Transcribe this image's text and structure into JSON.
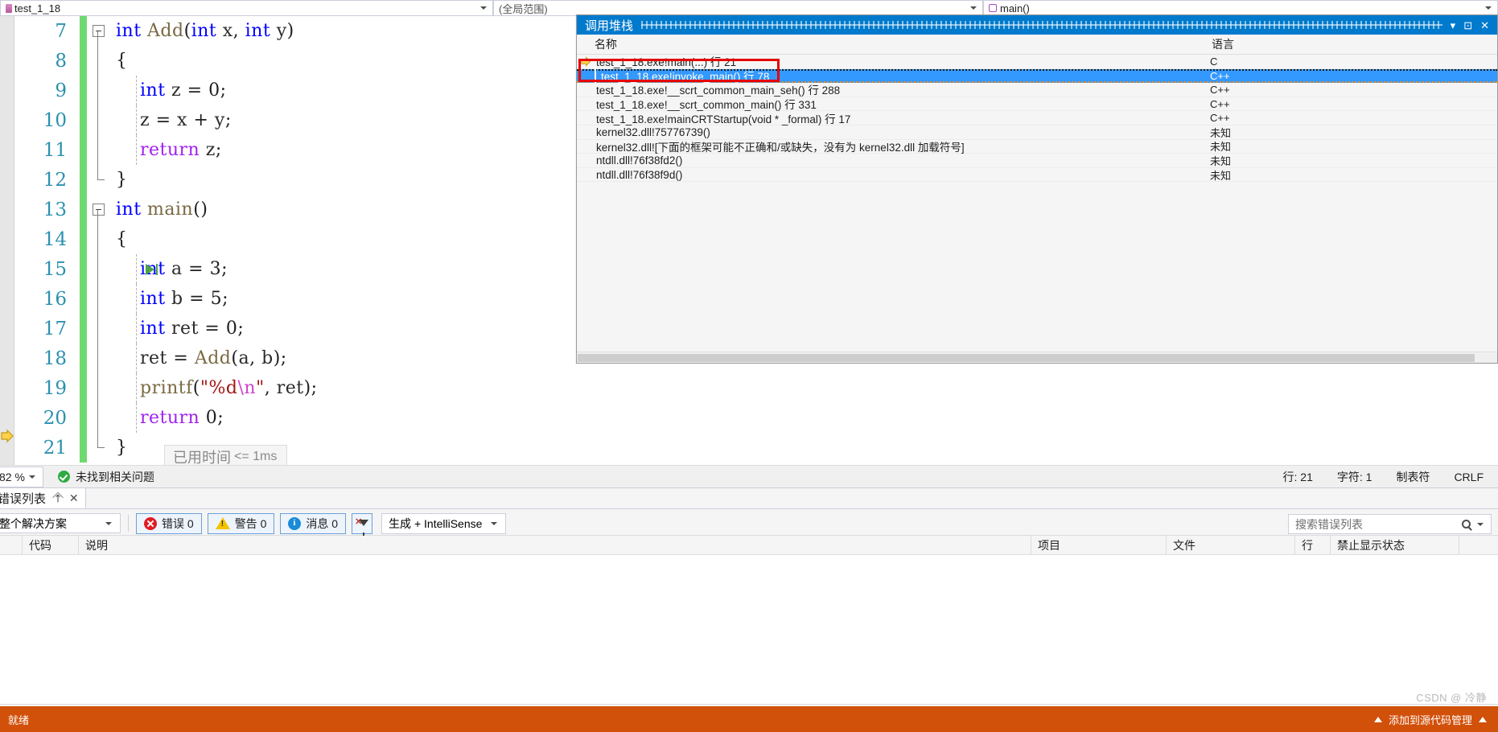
{
  "navbar": {
    "project_combo": "test_1_18",
    "scope_combo": "(全局范围)",
    "member_combo": "main()"
  },
  "editor": {
    "zoom_level": "82 %",
    "elapsed_label": "已用时间",
    "elapsed_value": "<= 1ms",
    "lines": [
      {
        "n": "7",
        "html": "<span class=\"kw\">int</span> <span class=\"fn\">Add</span><span class=\"brc\">(</span><span class=\"kw\">int</span> <span class=\"var\">x</span><span class=\"brc\">,</span> <span class=\"kw\">int</span> <span class=\"var\">y</span><span class=\"brc\">)</span>",
        "fold": "open",
        "indent": "none"
      },
      {
        "n": "8",
        "html": "<span class=\"brc\">{</span>",
        "fold": "none",
        "indent": "solid"
      },
      {
        "n": "9",
        "html": "    <span class=\"kw\">int</span> <span class=\"var\">z</span> <span class=\"brc\">=</span> <span class=\"num\">0</span><span class=\"brc\">;</span>",
        "fold": "none",
        "indent": "dash"
      },
      {
        "n": "10",
        "html": "    <span class=\"var\">z</span> <span class=\"brc\">=</span> <span class=\"var\">x</span> <span class=\"brc\">+</span> <span class=\"var\">y</span><span class=\"brc\">;</span>",
        "fold": "none",
        "indent": "dash"
      },
      {
        "n": "11",
        "html": "    <span class=\"ret\">return</span> <span class=\"var\">z</span><span class=\"brc\">;</span>",
        "fold": "none",
        "indent": "dash"
      },
      {
        "n": "12",
        "html": "<span class=\"brc\">}</span>",
        "fold": "none",
        "indent": "solid-end"
      },
      {
        "n": "13",
        "html": "<span class=\"kw\">int</span> <span class=\"fn\">main</span><span class=\"brc\">()</span>",
        "fold": "open",
        "indent": "none"
      },
      {
        "n": "14",
        "html": "<span class=\"brc\">{</span>",
        "fold": "none",
        "indent": "solid"
      },
      {
        "n": "15",
        "html": "    <span class=\"kw\">int</span> <span class=\"var\">a</span> <span class=\"brc\">=</span> <span class=\"num\">3</span><span class=\"brc\">;</span>",
        "fold": "none",
        "indent": "dash",
        "step_marker": true
      },
      {
        "n": "16",
        "html": "    <span class=\"kw\">int</span> <span class=\"var\">b</span> <span class=\"brc\">=</span> <span class=\"num\">5</span><span class=\"brc\">;</span>",
        "fold": "none",
        "indent": "dash"
      },
      {
        "n": "17",
        "html": "    <span class=\"kw\">int</span> <span class=\"var\">ret</span> <span class=\"brc\">=</span> <span class=\"num\">0</span><span class=\"brc\">;</span>",
        "fold": "none",
        "indent": "dash"
      },
      {
        "n": "18",
        "html": "    <span class=\"var\">ret</span> <span class=\"brc\">=</span> <span class=\"fn\">Add</span><span class=\"brc\">(</span><span class=\"var\">a</span><span class=\"brc\">,</span> <span class=\"var\">b</span><span class=\"brc\">);</span>",
        "fold": "none",
        "indent": "dash"
      },
      {
        "n": "19",
        "html": "    <span class=\"fn\">printf</span><span class=\"brc\">(</span><span class=\"str\">&quot;%d</span><span class=\"esc\">\\n</span><span class=\"str\">&quot;</span><span class=\"brc\">,</span> <span class=\"var\">ret</span><span class=\"brc\">);</span>",
        "fold": "none",
        "indent": "dash"
      },
      {
        "n": "20",
        "html": "    <span class=\"ret\">return</span> <span class=\"num\">0</span><span class=\"brc\">;</span>",
        "fold": "none",
        "indent": "dash"
      },
      {
        "n": "21",
        "html": "<span class=\"brc\">}</span>",
        "fold": "none",
        "indent": "solid-end",
        "exec_current": true
      }
    ]
  },
  "callstack": {
    "title": "调用堆栈",
    "header_name": "名称",
    "header_lang": "语言",
    "rows": [
      {
        "name": "test_1_18.exe!main(...) 行 21",
        "lang": "C",
        "marker": "yellow-arrow",
        "selected": false
      },
      {
        "name": "test_1_18.exe!invoke_main() 行 78",
        "lang": "C++",
        "marker": "none",
        "selected": true
      },
      {
        "name": "test_1_18.exe!__scrt_common_main_seh() 行 288",
        "lang": "C++",
        "marker": "none",
        "selected": false
      },
      {
        "name": "test_1_18.exe!__scrt_common_main() 行 331",
        "lang": "C++",
        "marker": "none",
        "selected": false
      },
      {
        "name": "test_1_18.exe!mainCRTStartup(void * _formal) 行 17",
        "lang": "C++",
        "marker": "none",
        "selected": false
      },
      {
        "name": "kernel32.dll!75776739()",
        "lang": "未知",
        "marker": "none",
        "selected": false
      },
      {
        "name": "kernel32.dll![下面的框架可能不正确和/或缺失，没有为 kernel32.dll 加载符号]",
        "lang": "未知",
        "marker": "none",
        "selected": false
      },
      {
        "name": "ntdll.dll!76f38fd2()",
        "lang": "未知",
        "marker": "none",
        "selected": false
      },
      {
        "name": "ntdll.dll!76f38f9d()",
        "lang": "未知",
        "marker": "none",
        "selected": false
      }
    ]
  },
  "statusbar": {
    "issues_text": "未找到相关问题",
    "line": "行: 21",
    "column": "字符: 1",
    "tabs": "制表符",
    "eol": "CRLF"
  },
  "errorlist": {
    "tab_label": "错误列表",
    "scope": "整个解决方案",
    "errors": "错误 0",
    "warnings": "警告 0",
    "messages": "消息 0",
    "build_filter": "生成 + IntelliSense",
    "search_placeholder": "搜索错误列表",
    "columns": [
      "",
      "代码",
      "说明",
      "项目",
      "文件",
      "行",
      "禁止显示状态"
    ]
  },
  "taskbar": {
    "left_label": "就绪",
    "right_label": "添加到源代码管理"
  },
  "watermark": "CSDN @ 冷静",
  "colors": {
    "accent_blue": "#007acc",
    "selection_blue": "#3399ff",
    "annotation_red": "#e60000",
    "change_green": "#6fd96f",
    "taskbar_orange": "#d1500a"
  }
}
